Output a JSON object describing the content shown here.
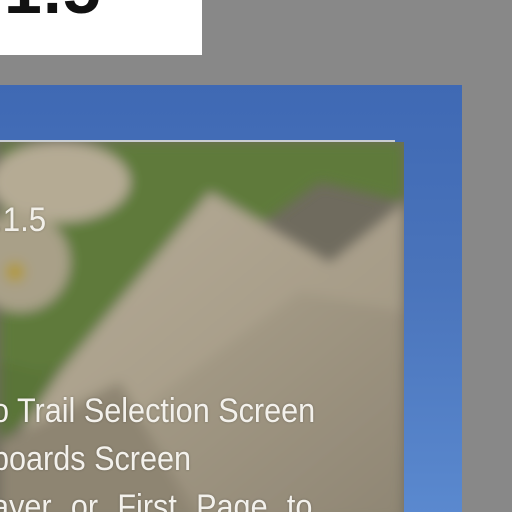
{
  "version_banner": {
    "text": "1.5"
  },
  "game_screen": {
    "version_label": ".1.5",
    "menu_lines": [
      "o Trail Selection Screen",
      "boards Screen",
      "ayer or First Page to"
    ]
  },
  "colors": {
    "background": "#888888",
    "frame_blue": "#4a74bb",
    "banner_white": "#ffffff",
    "grass_green": "#5f7a3a",
    "rock_tan": "#a89e8a",
    "text_light": "#f3f1ec"
  }
}
